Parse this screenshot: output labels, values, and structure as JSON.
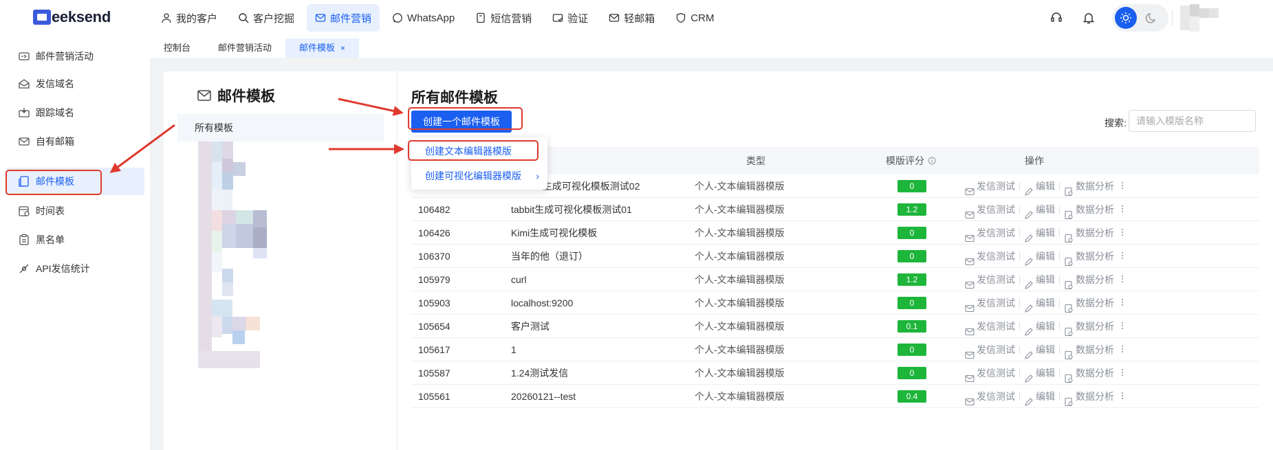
{
  "brand": {
    "name": "eeksend"
  },
  "nav": [
    {
      "label": "我的客户",
      "icon": "user-icon",
      "active": false
    },
    {
      "label": "客户挖掘",
      "icon": "search-icon",
      "active": false
    },
    {
      "label": "邮件营销",
      "icon": "mail-icon",
      "active": true
    },
    {
      "label": "WhatsApp",
      "icon": "whatsapp-icon",
      "active": false
    },
    {
      "label": "短信营销",
      "icon": "sms-icon",
      "active": false
    },
    {
      "label": "验证",
      "icon": "verify-icon",
      "active": false
    },
    {
      "label": "轻邮箱",
      "icon": "light-mailbox-icon",
      "active": false
    },
    {
      "label": "CRM",
      "icon": "crm-icon",
      "active": false
    }
  ],
  "tabs": [
    {
      "label": "控制台",
      "active": false
    },
    {
      "label": "邮件营销活动",
      "active": false
    },
    {
      "label": "邮件模板",
      "active": true,
      "close": "×"
    }
  ],
  "sidebar": [
    {
      "label": "邮件营销活动",
      "icon": "campaign-icon",
      "active": false
    },
    {
      "label": "发信域名",
      "icon": "domain-icon",
      "active": false
    },
    {
      "label": "跟踪域名",
      "icon": "tracking-icon",
      "active": false
    },
    {
      "label": "自有邮箱",
      "icon": "mailbox-icon",
      "active": false
    },
    {
      "label": "邮件模板",
      "icon": "template-icon",
      "active": true
    },
    {
      "label": "时间表",
      "icon": "schedule-icon",
      "active": false
    },
    {
      "label": "黑名单",
      "icon": "blacklist-icon",
      "active": false
    },
    {
      "label": "API发信统计",
      "icon": "api-icon",
      "active": false
    }
  ],
  "left_panel": {
    "title": "邮件模板",
    "all_templates": "所有模板"
  },
  "main": {
    "title": "所有邮件模板",
    "create_button": "创建一个邮件模板",
    "search_label": "搜索:",
    "search_placeholder": "请输入模版名称",
    "columns": {
      "type": "类型",
      "score": "模版评分",
      "actions": "操作"
    },
    "row_actions": {
      "test": "发信测试",
      "edit": "编辑",
      "analytics": "数据分析"
    },
    "rows": [
      {
        "id": "",
        "name": "bit生成可视化模板测试02",
        "type": "个人-文本编辑器模版",
        "score": "0"
      },
      {
        "id": "106482",
        "name": "tabbit生成可视化模板测试01",
        "type": "个人-文本编辑器模版",
        "score": "1.2"
      },
      {
        "id": "106426",
        "name": "Kimi生成可视化模板",
        "type": "个人-文本编辑器模版",
        "score": "0"
      },
      {
        "id": "106370",
        "name": "当年的他（退订）",
        "type": "个人-文本编辑器模版",
        "score": "0"
      },
      {
        "id": "105979",
        "name": "curl",
        "type": "个人-文本编辑器模版",
        "score": "1.2"
      },
      {
        "id": "105903",
        "name": "localhost:9200",
        "type": "个人-文本编辑器模版",
        "score": "0"
      },
      {
        "id": "105654",
        "name": "客户测试",
        "type": "个人-文本编辑器模版",
        "score": "0.1"
      },
      {
        "id": "105617",
        "name": "1",
        "type": "个人-文本编辑器模版",
        "score": "0"
      },
      {
        "id": "105587",
        "name": "1.24测试发信",
        "type": "个人-文本编辑器模版",
        "score": "0"
      },
      {
        "id": "105561",
        "name": "20260121--test",
        "type": "个人-文本编辑器模版",
        "score": "0.4"
      }
    ]
  },
  "dropdown": {
    "items": [
      {
        "label": "创建文本编辑器模版",
        "arrow": "›"
      },
      {
        "label": "创建可视化编辑器模版",
        "arrow": "›"
      }
    ]
  },
  "colors": {
    "accent": "#1a5ff0",
    "score_green": "#1db53a",
    "annotation_red": "#e03a2f"
  }
}
